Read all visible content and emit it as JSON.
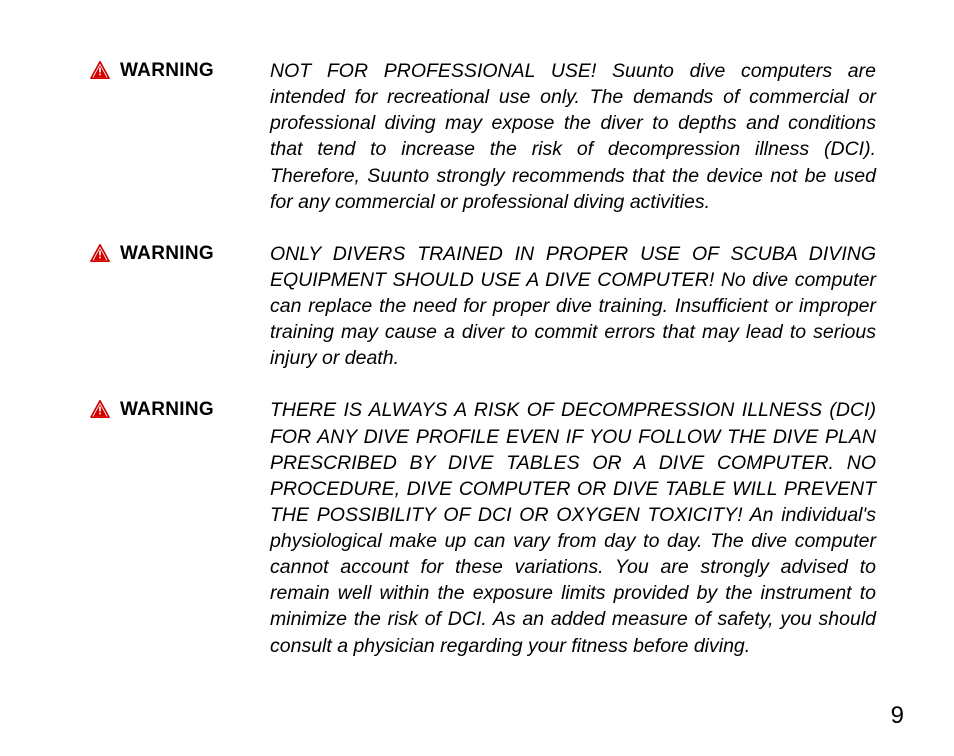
{
  "warnings": [
    {
      "label": "WARNING",
      "body": "NOT FOR PROFESSIONAL USE! Suunto dive computers are intended for recreational use only. The demands of commercial or professional diving may expose the diver to depths and conditions that tend to increase the risk of decompression illness (DCI). Therefore, Suunto strongly recommends that the device not be used for any commercial or professional diving activities."
    },
    {
      "label": "WARNING",
      "body": "ONLY DIVERS TRAINED IN PROPER USE OF SCUBA DIVING EQUIPMENT SHOULD USE A DIVE COMPUTER! No dive computer can replace the need for proper dive training. Insufficient or improper training may cause a diver to commit errors that may lead to serious injury or death."
    },
    {
      "label": "WARNING",
      "body": "THERE IS ALWAYS A RISK OF DECOMPRESSION ILLNESS (DCI) FOR ANY DIVE PROFILE EVEN IF YOU FOLLOW THE DIVE PLAN PRESCRIBED BY DIVE TABLES OR A DIVE COMPUTER. NO PROCEDURE, DIVE COMPUTER OR DIVE TABLE WILL PREVENT THE POSSIBILITY OF DCI OR OXYGEN TOXICITY! An individual's physiological make up can vary from day to day. The dive computer cannot account for these variations. You are strongly advised to remain well within the exposure limits provided by the instrument to minimize the risk of DCI. As an added measure of safety, you should consult a physician regarding your fitness before diving."
    }
  ],
  "page_number": "9"
}
